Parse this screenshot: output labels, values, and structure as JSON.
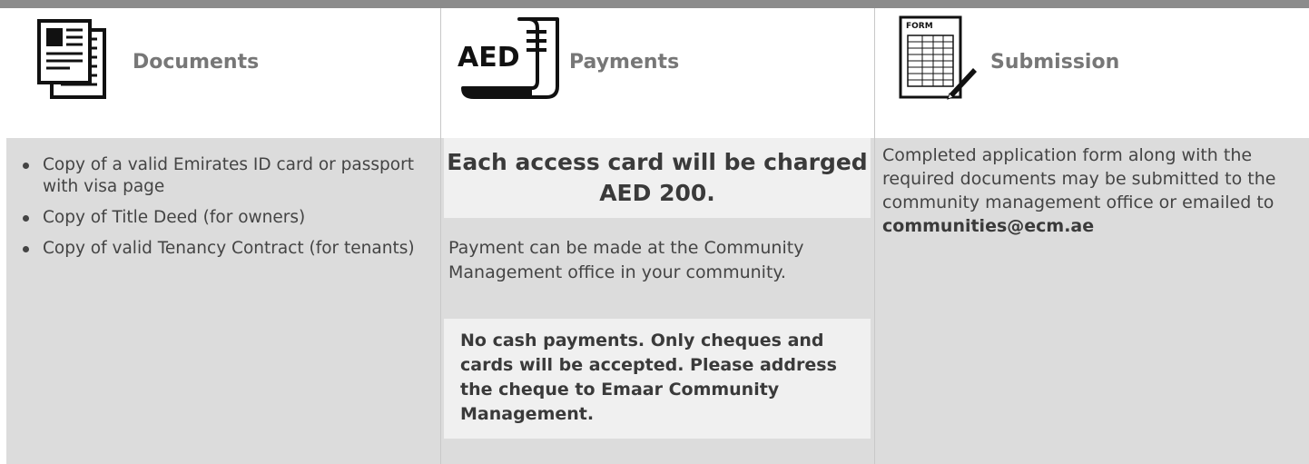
{
  "documents": {
    "title": "Documents",
    "items": [
      "Copy of a valid Emirates ID card or passport with visa page",
      "Copy of Title Deed (for owners)",
      "Copy of valid Tenancy Contract (for tenants)"
    ]
  },
  "payments": {
    "title": "Payments",
    "icon_text": "AED",
    "headline": "Each access card will be charged AED 200.",
    "text": "Payment can be made at the Community Management office in your community.",
    "notice": "No cash payments. Only cheques and cards will be accepted. Please address the cheque to Emaar Community Management."
  },
  "submission": {
    "title": "Submission",
    "icon_text": "FORM",
    "text": "Completed application form along with the required documents may be submitted to the community management office or emailed to",
    "email": "communities@ecm.ae"
  },
  "colors": {
    "topbar": "#8c8c8c",
    "panel": "#dcdcdc",
    "highlight": "#f0f0f0",
    "title": "#777777"
  }
}
